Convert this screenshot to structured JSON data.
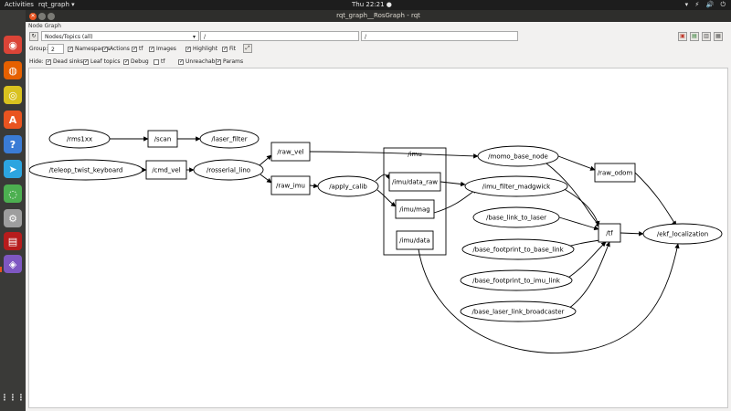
{
  "topbar": {
    "activities": "Activities",
    "app_menu": "rqt_graph ▾",
    "clock": "Thu 22:21 ●",
    "tray": [
      "▾",
      "⚡",
      "🔊",
      "⏻"
    ]
  },
  "dock": {
    "items": [
      {
        "name": "chrome-icon",
        "glyph": "◉",
        "color": "#db4437"
      },
      {
        "name": "firefox-icon",
        "glyph": "◍",
        "color": "#e66000"
      },
      {
        "name": "rhythmbox-icon",
        "glyph": "◎",
        "color": "#d9c21f"
      },
      {
        "name": "software-center-icon",
        "glyph": "A",
        "color": "#e95420"
      },
      {
        "name": "help-icon",
        "glyph": "?",
        "color": "#3a7bd5"
      },
      {
        "name": "telegram-icon",
        "glyph": "➤",
        "color": "#2ca5e0"
      },
      {
        "name": "network-icon",
        "glyph": "◌",
        "color": "#4caf50"
      },
      {
        "name": "settings-icon",
        "glyph": "⚙",
        "color": "#9e9e9e"
      },
      {
        "name": "system-monitor-icon",
        "glyph": "▤",
        "color": "#b71c1c"
      },
      {
        "name": "rqt-icon",
        "glyph": "◈",
        "color": "#7e57c2"
      }
    ],
    "apps_grid": "⋮⋮⋮"
  },
  "window": {
    "title": "rqt_graph__RosGraph - rqt",
    "panel_title": "Node Graph"
  },
  "toolbar": {
    "refresh_icon": "↻",
    "mode_select": "Nodes/Topics (all)",
    "ns_filter": "/",
    "topic_filter": "/",
    "right_icons": [
      "▣",
      "▤",
      "▥",
      "▦"
    ],
    "group_label": "Group:",
    "group_value": "2",
    "options": [
      {
        "label": "Namespaces",
        "checked": true
      },
      {
        "label": "Actions",
        "checked": true
      },
      {
        "label": "tf",
        "checked": true
      },
      {
        "label": "Images",
        "checked": true
      },
      {
        "label": "Highlight",
        "checked": true
      },
      {
        "label": "Fit",
        "checked": true
      }
    ],
    "fit_button": "⤢",
    "hide_label": "Hide:",
    "hide_options": [
      {
        "label": "Dead sinks",
        "checked": true
      },
      {
        "label": "Leaf topics",
        "checked": true
      },
      {
        "label": "Debug",
        "checked": true
      },
      {
        "label": "tf",
        "checked": false
      },
      {
        "label": "Unreachable",
        "checked": true
      },
      {
        "label": "Params",
        "checked": true
      }
    ]
  },
  "graph": {
    "group_label": "/imu",
    "nodes": [
      {
        "label": "/rms1xx",
        "shape": "ellipse"
      },
      {
        "label": "/scan",
        "shape": "box"
      },
      {
        "label": "/laser_filter",
        "shape": "ellipse"
      },
      {
        "label": "/teleop_twist_keyboard",
        "shape": "ellipse"
      },
      {
        "label": "/cmd_vel",
        "shape": "box"
      },
      {
        "label": "/rosserial_lino",
        "shape": "ellipse"
      },
      {
        "label": "/raw_vel",
        "shape": "box"
      },
      {
        "label": "/raw_imu",
        "shape": "box"
      },
      {
        "label": "/apply_calib",
        "shape": "ellipse"
      },
      {
        "label": "/imu/data_raw",
        "shape": "box"
      },
      {
        "label": "/imu/mag",
        "shape": "box"
      },
      {
        "label": "/imu/data",
        "shape": "box"
      },
      {
        "label": "/momo_base_node",
        "shape": "ellipse"
      },
      {
        "label": "/raw_odom",
        "shape": "box"
      },
      {
        "label": "/imu_filter_madgwick",
        "shape": "ellipse"
      },
      {
        "label": "/base_link_to_laser",
        "shape": "ellipse"
      },
      {
        "label": "/base_footprint_to_base_link",
        "shape": "ellipse"
      },
      {
        "label": "/base_footprint_to_imu_link",
        "shape": "ellipse"
      },
      {
        "label": "/base_laser_link_broadcaster",
        "shape": "ellipse"
      },
      {
        "label": "/tf",
        "shape": "box"
      },
      {
        "label": "/ekf_localization",
        "shape": "ellipse"
      }
    ]
  }
}
